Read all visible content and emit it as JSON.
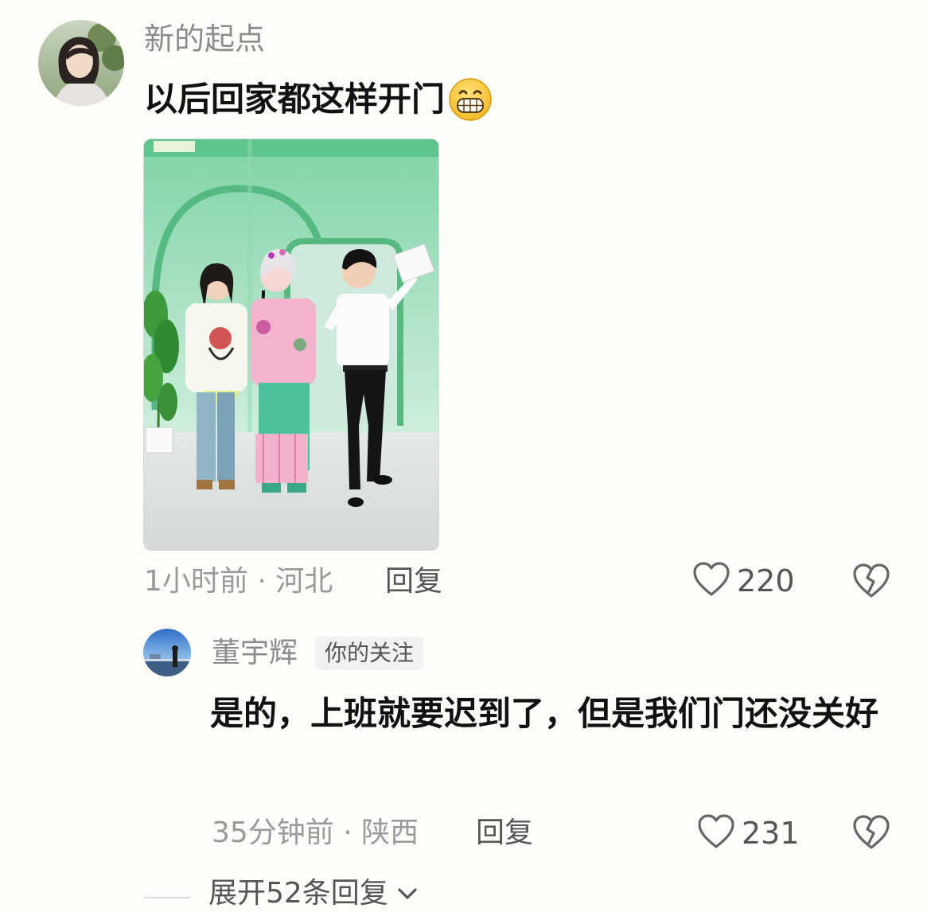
{
  "main_comment": {
    "username": "新的起点",
    "text": "以后回家都这样开门",
    "emoji": "grinning-face-emoji",
    "time": "1小时前 · 河北",
    "reply_label": "回复",
    "likes": "220"
  },
  "reply": {
    "username": "董宇辉",
    "badge": "你的关注",
    "text": "是的，上班就要迟到了，但是我们门还没关好",
    "time": "35分钟前 · 陕西",
    "reply_label": "回复",
    "likes": "231"
  },
  "expand": {
    "label": "展开52条回复"
  },
  "icons": {
    "like": "heart-outline-icon",
    "dislike": "broken-heart-icon",
    "expand": "chevron-down-icon"
  }
}
